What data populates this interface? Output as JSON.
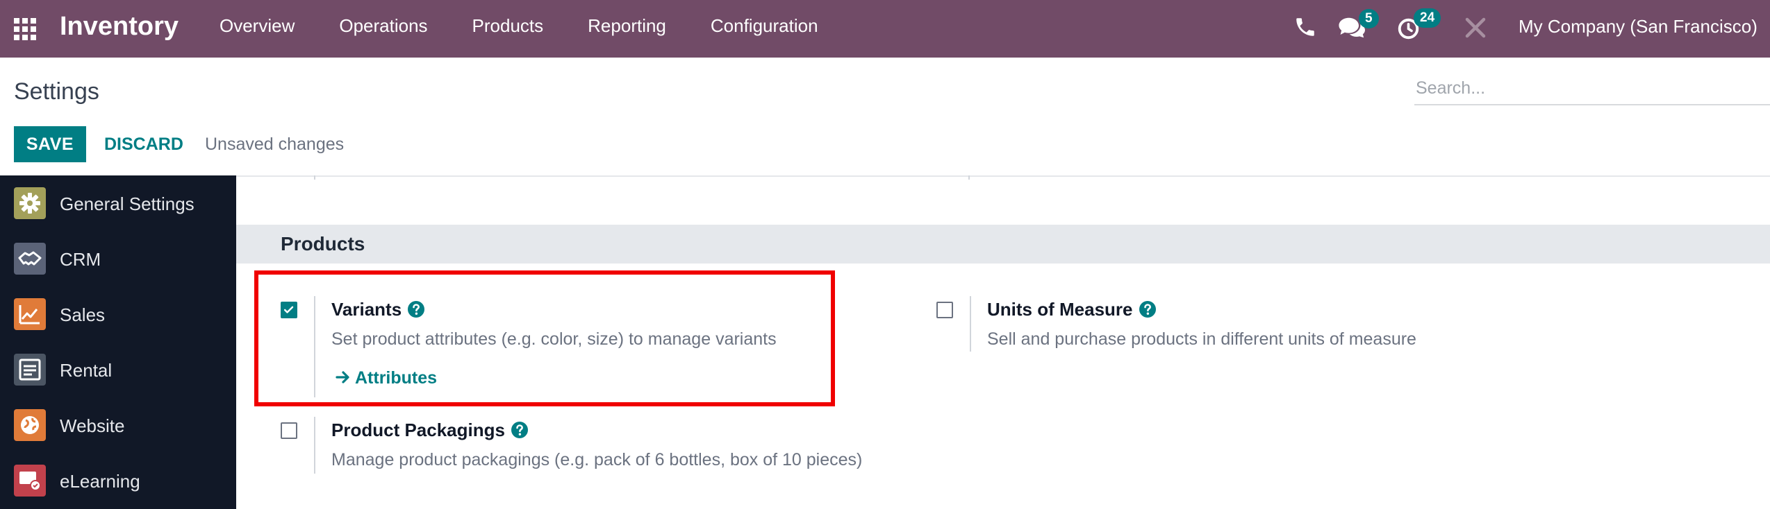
{
  "nav": {
    "app_name": "Inventory",
    "menu": [
      "Overview",
      "Operations",
      "Products",
      "Reporting",
      "Configuration"
    ],
    "chat_badge": "5",
    "activity_badge": "24",
    "company": "My Company (San Francisco)",
    "icons": [
      "apps-grid-icon",
      "phone-icon",
      "chat-icon",
      "activity-clock-icon",
      "tools-icon"
    ]
  },
  "control_panel": {
    "title": "Settings",
    "search_placeholder": "Search...",
    "save_label": "SAVE",
    "discard_label": "DISCARD",
    "status": "Unsaved changes"
  },
  "sidebar": {
    "items": [
      {
        "label": "General Settings",
        "icon": "gear-icon",
        "color": "#a3a05a"
      },
      {
        "label": "CRM",
        "icon": "handshake-icon",
        "color": "#5b6378"
      },
      {
        "label": "Sales",
        "icon": "sales-chart-icon",
        "color": "#e07b39"
      },
      {
        "label": "Rental",
        "icon": "rental-icon",
        "color": "#4b5563"
      },
      {
        "label": "Website",
        "icon": "globe-icon",
        "color": "#e07b39"
      },
      {
        "label": "eLearning",
        "icon": "elearning-icon",
        "color": "#c2414c"
      }
    ]
  },
  "section": {
    "title": "Products",
    "settings": [
      {
        "title": "Variants",
        "description": "Set product attributes (e.g. color, size) to manage variants",
        "checked": true,
        "link": "Attributes"
      },
      {
        "title": "Units of Measure",
        "description": "Sell and purchase products in different units of measure",
        "checked": false
      },
      {
        "title": "Product Packagings",
        "description": "Manage product packagings (e.g. pack of 6 bottles, box of 10 pieces)",
        "checked": false
      }
    ]
  },
  "colors": {
    "navbar": "#714b67",
    "primary": "#017e84",
    "sidebar": "#111827",
    "section_header": "#e5e8ec",
    "highlight": "#f00000"
  }
}
